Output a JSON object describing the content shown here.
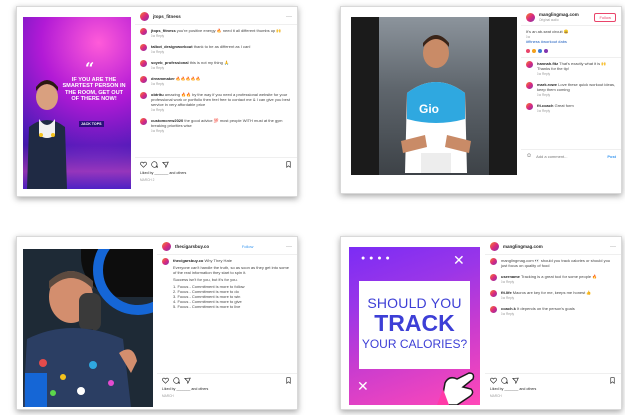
{
  "colors": {
    "instagram_gradient": "#dd2a7b",
    "post1_bg": "#b21ad6",
    "post4_text": "#3d3fd6",
    "follow_accent": "#e9446a"
  },
  "posts": [
    {
      "image_text": {
        "quote_mark": "“",
        "headline": "IF YOU ARE THE SMARTEST PERSON IN THE ROOM, GET OUT OF THERE NOW!",
        "name_badge": "JACK TOPS"
      },
      "header": {
        "username": "jtops_fitness"
      },
      "comments": [
        {
          "user": "jtops_fitness",
          "text": "you're positive energy 🔥 need it all different thumbs up 🙌",
          "meta": "1w   Reply"
        },
        {
          "user": "talbot_designworkout",
          "text": "thank to be as different as I can!",
          "meta": "1w   Reply"
        },
        {
          "user": "soyeb_professional",
          "text": "this is not my thing 🙏",
          "meta": "1w   Reply"
        },
        {
          "user": "dreammaker",
          "text": "🔥🔥🔥🔥🔥",
          "meta": "1w   Reply"
        },
        {
          "user": "obtritu",
          "text": "amazing 🔥🔥 by the way if you need a professional website for your professional work or portfolio then feel free to contact me & I can give you best service in very affordable price",
          "meta": "1w   Reply"
        },
        {
          "user": "customcrew2020",
          "text": "the good advice 💯 most people WITH must at the gym breaking priorities wise",
          "meta": "1w   Reply"
        }
      ],
      "likes": "Liked by _______ and others",
      "date": "MARCH 2"
    },
    {
      "header": {
        "username": "manglingmag.com",
        "sub": "Original audio",
        "follow": "Follow"
      },
      "caption": "It's an ab-seat circuit 😀",
      "caption_meta": "1w",
      "comments": [
        {
          "user": "hannah.fitz",
          "text": "That's exactly what it is 🙌 Thanks for the tip!",
          "meta": "1w   Reply"
        },
        {
          "user": "mark.rowe",
          "text": "Love these quick workout ideas, keep them coming",
          "meta": "1w   Reply"
        },
        {
          "user": "fit.coach",
          "text": "Great form",
          "meta": "1w   Reply"
        }
      ],
      "tags": "#fitness #workout #abs",
      "add_comment_placeholder": "Add a comment...",
      "post_btn": "Post"
    },
    {
      "header": {
        "username": "thecigarsbuy.co",
        "follow": "Follow"
      },
      "caption_user": "thecigarsbuy.co",
      "caption": "Why They Hate",
      "paragraphs": [
        "Everyone can't handle the truth, so as soon as they get into some of the real information they start to spin it.",
        "Success isn't for you, but it's for you.",
        "1. Focus - Commitment is more to follow",
        "2. Focus - Commitment is more to do",
        "3. Focus - Commitment is more to win",
        "4. Focus - Commitment is more to give",
        "5. Focus - Commitment is more to live"
      ],
      "likes": "Liked by _______ and others",
      "date": "MARCH"
    },
    {
      "image_text": {
        "line1": "SHOULD YOU",
        "line2": "TRACK",
        "line3": "YOUR CALORIES?",
        "dots": "● ● ● ●",
        "x1": "✕",
        "x2": "✕"
      },
      "header": {
        "username": "manglingmag.com"
      },
      "caption": "manglingmag.com 👀 should you track calories or should you just focus on quality of food",
      "comments": [
        {
          "user": "username",
          "text": "Tracking is a great tool for some people 🔥",
          "meta": "1w   Reply"
        },
        {
          "user": "fit.life",
          "text": "Macros are key for me, keeps me honest 👍",
          "meta": "1w   Reply"
        },
        {
          "user": "coach.k",
          "text": "It depends on the person's goals",
          "meta": "1w   Reply"
        }
      ],
      "likes": "Liked by _______ and others",
      "date": "MARCH"
    }
  ]
}
